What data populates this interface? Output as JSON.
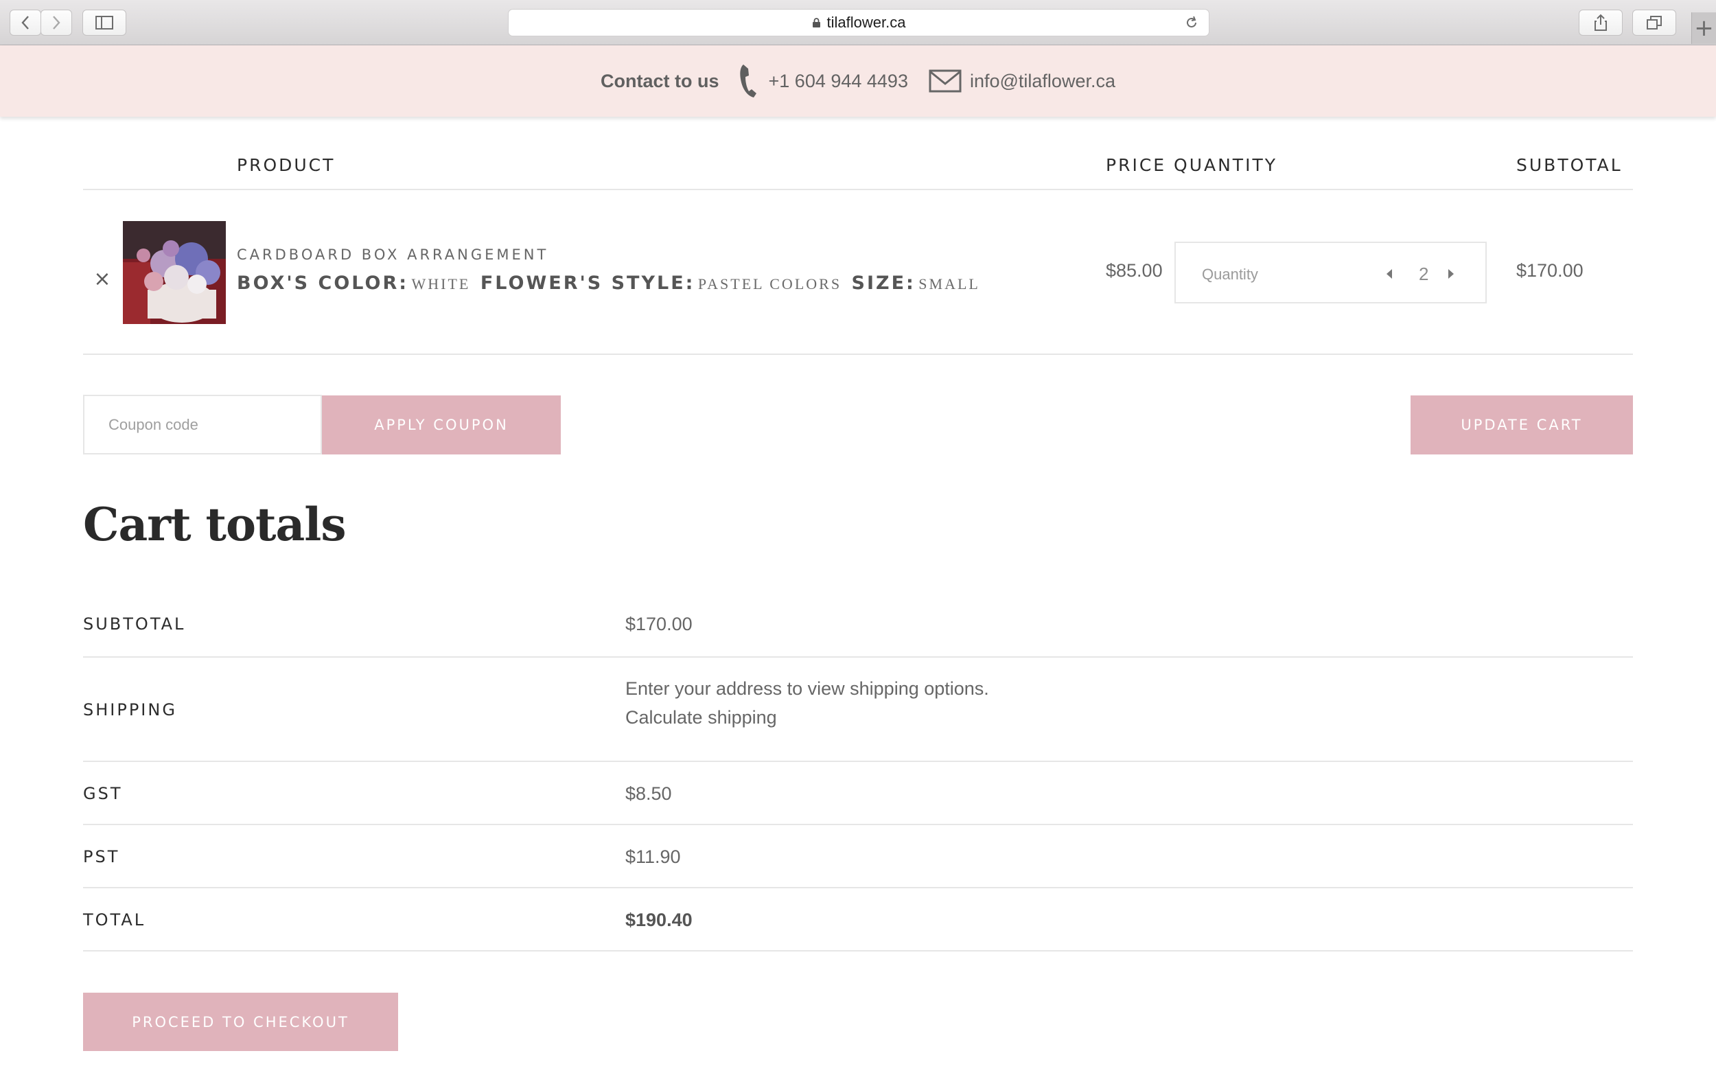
{
  "browser": {
    "url": "tilaflower.ca",
    "new_tab": "+"
  },
  "contact_bar": {
    "label": "Contact to us",
    "phone": "+1 604 944 4493",
    "email": "info@tilaflower.ca"
  },
  "cart_table": {
    "headers": {
      "product": "PRODUCT",
      "price_quantity": "PRICE QUANTITY",
      "subtotal": "SUBTOTAL"
    },
    "item": {
      "remove": "×",
      "name": "CARDBOARD BOX ARRANGEMENT",
      "options": [
        {
          "key": "BOX'S COLOR:",
          "value": "WHITE"
        },
        {
          "key": "FLOWER'S STYLE:",
          "value": "PASTEL COLORS"
        },
        {
          "key": "SIZE:",
          "value": "SMALL"
        }
      ],
      "price": "$85.00",
      "quantity_label": "Quantity",
      "quantity": "2",
      "subtotal": "$170.00"
    }
  },
  "coupon": {
    "placeholder": "Coupon code",
    "apply_label": "APPLY COUPON"
  },
  "update_cart_label": "UPDATE CART",
  "cart_totals": {
    "title": "Cart totals",
    "subtotal_label": "SUBTOTAL",
    "subtotal_value": "$170.00",
    "shipping_label": "SHIPPING",
    "shipping_note": "Enter your address to view shipping options.",
    "shipping_link": "Calculate shipping",
    "gst_label": "GST",
    "gst_value": "$8.50",
    "pst_label": "PST",
    "pst_value": "$11.90",
    "total_label": "TOTAL",
    "total_value": "$190.40"
  },
  "checkout_label": "PROCEED TO CHECKOUT",
  "colors": {
    "accent_pink": "#e0b3bb",
    "contact_bg": "#f8e8e6"
  }
}
